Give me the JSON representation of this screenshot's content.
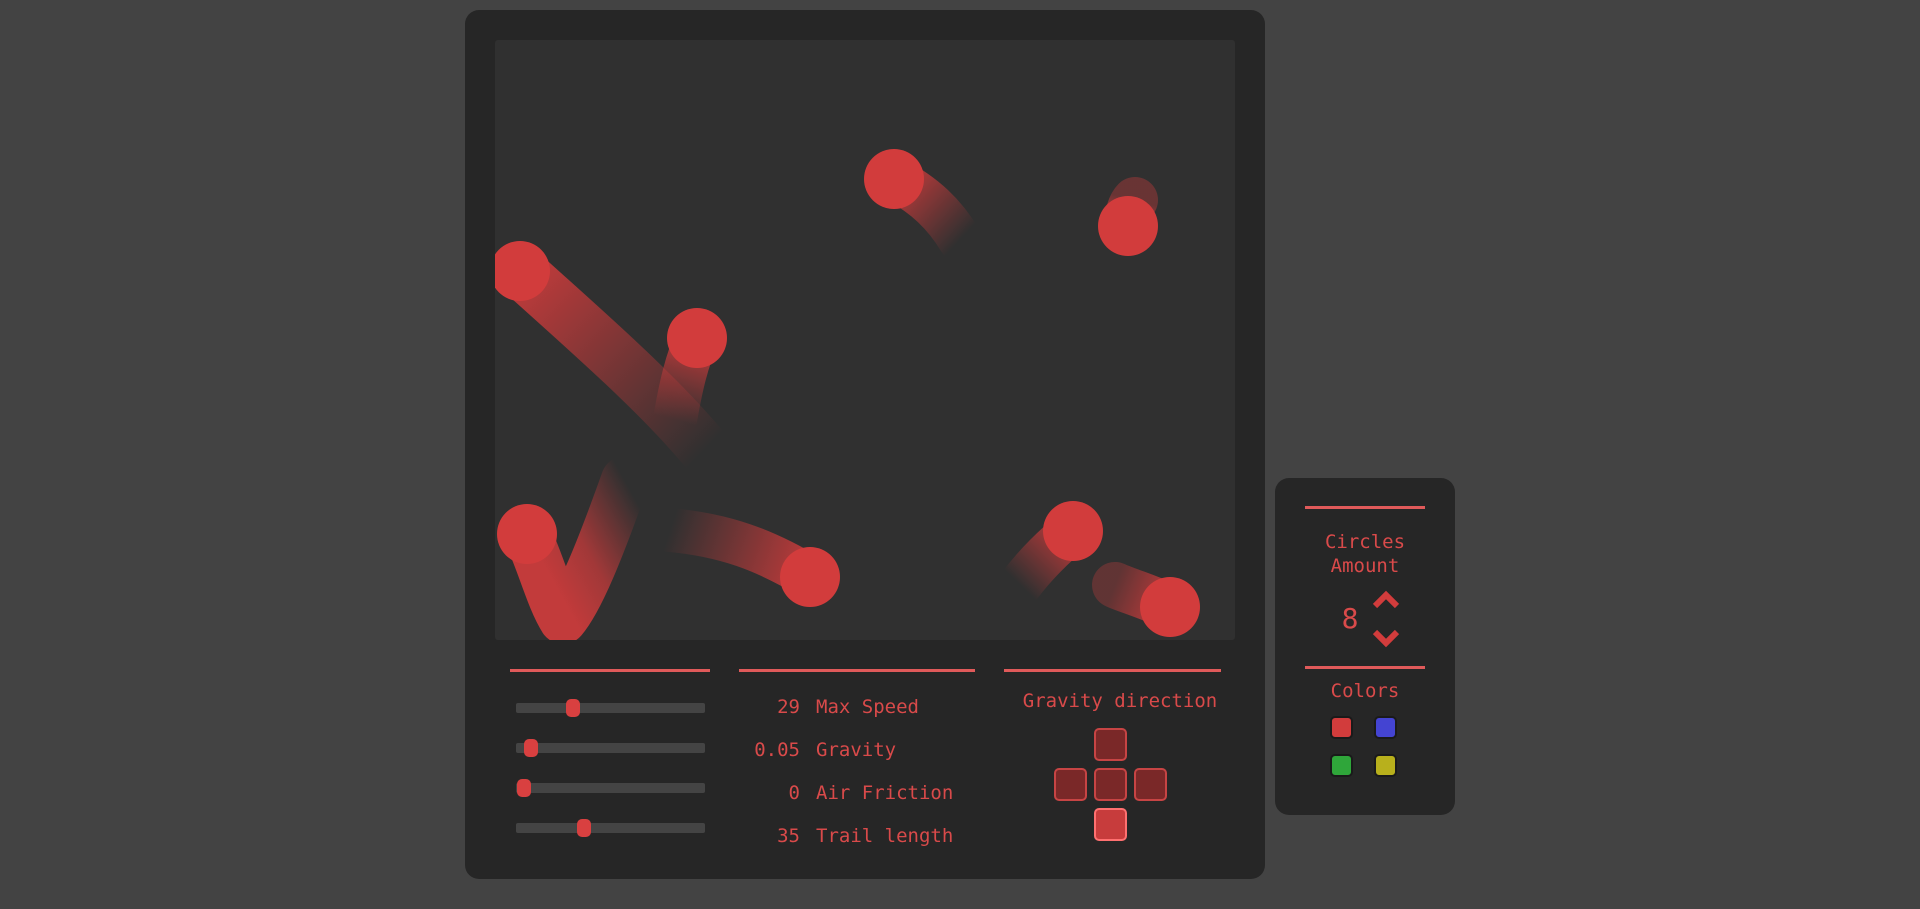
{
  "controls": {
    "max_speed": {
      "value": "29",
      "label": "Max Speed",
      "fraction": 0.3
    },
    "gravity": {
      "value": "0.05",
      "label": "Gravity",
      "fraction": 0.08
    },
    "air_friction": {
      "value": "0",
      "label": "Air Friction",
      "fraction": 0.04
    },
    "trail_length": {
      "value": "35",
      "label": "Trail length",
      "fraction": 0.36
    }
  },
  "gravity_direction": {
    "title": "Gravity direction",
    "buttons": [
      "up",
      "left",
      "center",
      "right",
      "down"
    ],
    "active": "down"
  },
  "circles": {
    "title_line1": "Circles",
    "title_line2": "Amount",
    "count": "8"
  },
  "colors": {
    "title": "Colors",
    "swatches": [
      {
        "name": "red",
        "hex": "#d23c3c"
      },
      {
        "name": "blue",
        "hex": "#4444d2"
      },
      {
        "name": "green",
        "hex": "#2fa63a"
      },
      {
        "name": "yellow",
        "hex": "#b8b01c"
      }
    ]
  },
  "accent_color": "#d23c3c"
}
